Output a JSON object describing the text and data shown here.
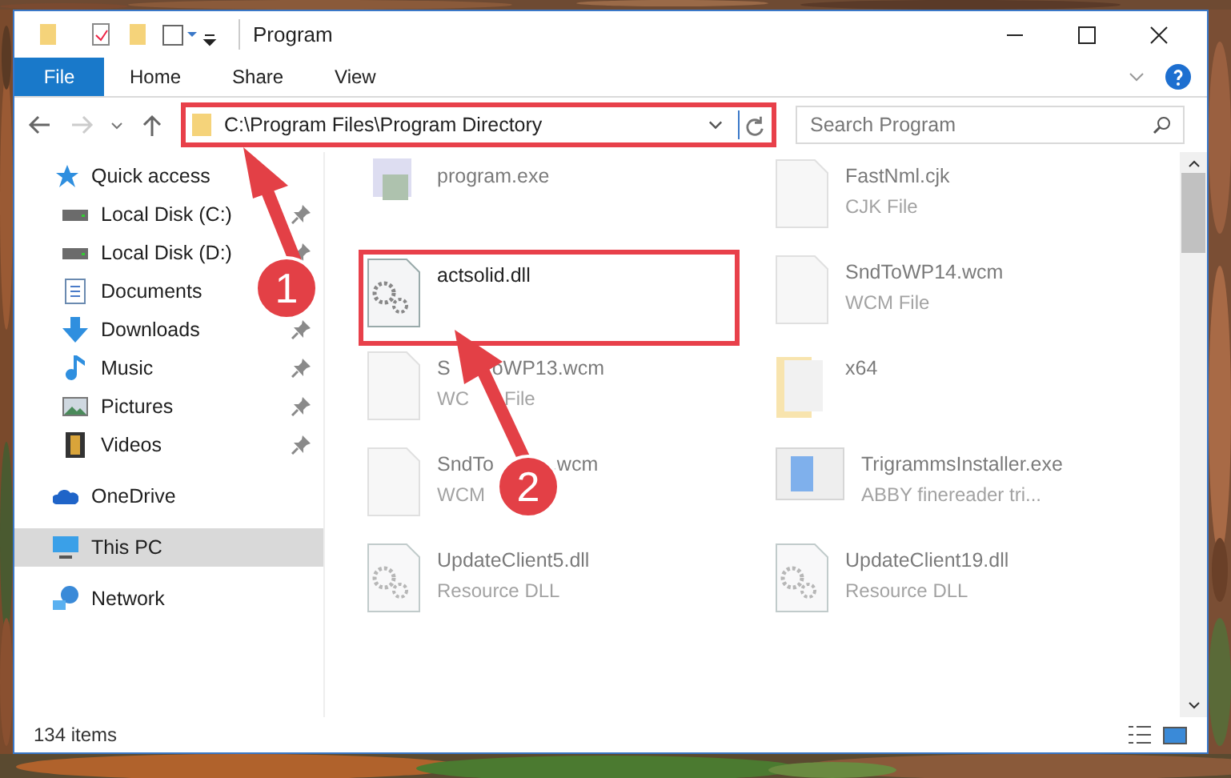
{
  "window": {
    "title": "Program"
  },
  "ribbon_tabs": [
    {
      "label": "File",
      "selected": true
    },
    {
      "label": "Home",
      "selected": false
    },
    {
      "label": "Share",
      "selected": false
    },
    {
      "label": "View",
      "selected": false
    }
  ],
  "address_bar": {
    "path": "C:\\Program Files\\Program Directory",
    "highlighted": true
  },
  "search": {
    "placeholder": "Search Program"
  },
  "sidebar": {
    "items": [
      {
        "label": "Quick access",
        "kind": "star",
        "pinned": false,
        "selected": false,
        "children": [
          {
            "label": "Local Disk (C:)",
            "kind": "disk",
            "pinned": true,
            "selected": false
          },
          {
            "label": "Local Disk (D:)",
            "kind": "disk",
            "pinned": true,
            "selected": false
          },
          {
            "label": "Documents",
            "kind": "doc",
            "selected": false
          },
          {
            "label": "Downloads",
            "kind": "download",
            "pinned": true,
            "selected": false
          },
          {
            "label": "Music",
            "kind": "music",
            "pinned": true,
            "selected": false
          },
          {
            "label": "Pictures",
            "kind": "picture",
            "pinned": true,
            "selected": false
          },
          {
            "label": "Videos",
            "kind": "video",
            "pinned": true,
            "selected": false
          }
        ]
      },
      {
        "label": "OneDrive",
        "kind": "cloud",
        "pinned": false,
        "selected": false
      },
      {
        "label": "This PC",
        "kind": "pc",
        "pinned": false,
        "selected": true
      },
      {
        "label": "Network",
        "kind": "network",
        "pinned": false,
        "selected": false
      }
    ]
  },
  "files": [
    {
      "name": "program.exe",
      "kind": "exe",
      "highlighted": false,
      "faded": true
    },
    {
      "name": "FastNml.cjk",
      "type": "CJK File",
      "kind": "blank",
      "highlighted": false,
      "faded": true
    },
    {
      "name": "actsolid.dll",
      "kind": "gear",
      "highlighted": true,
      "faded": false
    },
    {
      "name": "SndToWP14.wcm",
      "type": "WCM File",
      "kind": "blank",
      "highlighted": false,
      "faded": true
    },
    {
      "name_parts": [
        "S",
        "oWP13.wcm"
      ],
      "type_parts": [
        "WC",
        "File"
      ],
      "kind": "blank",
      "highlighted": false,
      "faded": true
    },
    {
      "name": "x64",
      "kind": "folder",
      "highlighted": false,
      "faded": true
    },
    {
      "name_parts": [
        "SndTo",
        ".wcm"
      ],
      "type": "WCM",
      "kind": "blank",
      "highlighted": false,
      "faded": true
    },
    {
      "name": "TrigrammsInstaller.exe",
      "type": "ABBY finereader tri...",
      "kind": "installer",
      "highlighted": false,
      "faded": true
    },
    {
      "name": "UpdateClient5.dll",
      "type": "Resource DLL",
      "kind": "gear",
      "highlighted": false,
      "faded": true
    },
    {
      "name": "UpdateClient19.dll",
      "type": "Resource DLL",
      "kind": "gear",
      "highlighted": false,
      "faded": true
    }
  ],
  "status_bar": {
    "item_count": "134 items"
  },
  "callouts": [
    {
      "number": "1"
    },
    {
      "number": "2"
    }
  ]
}
